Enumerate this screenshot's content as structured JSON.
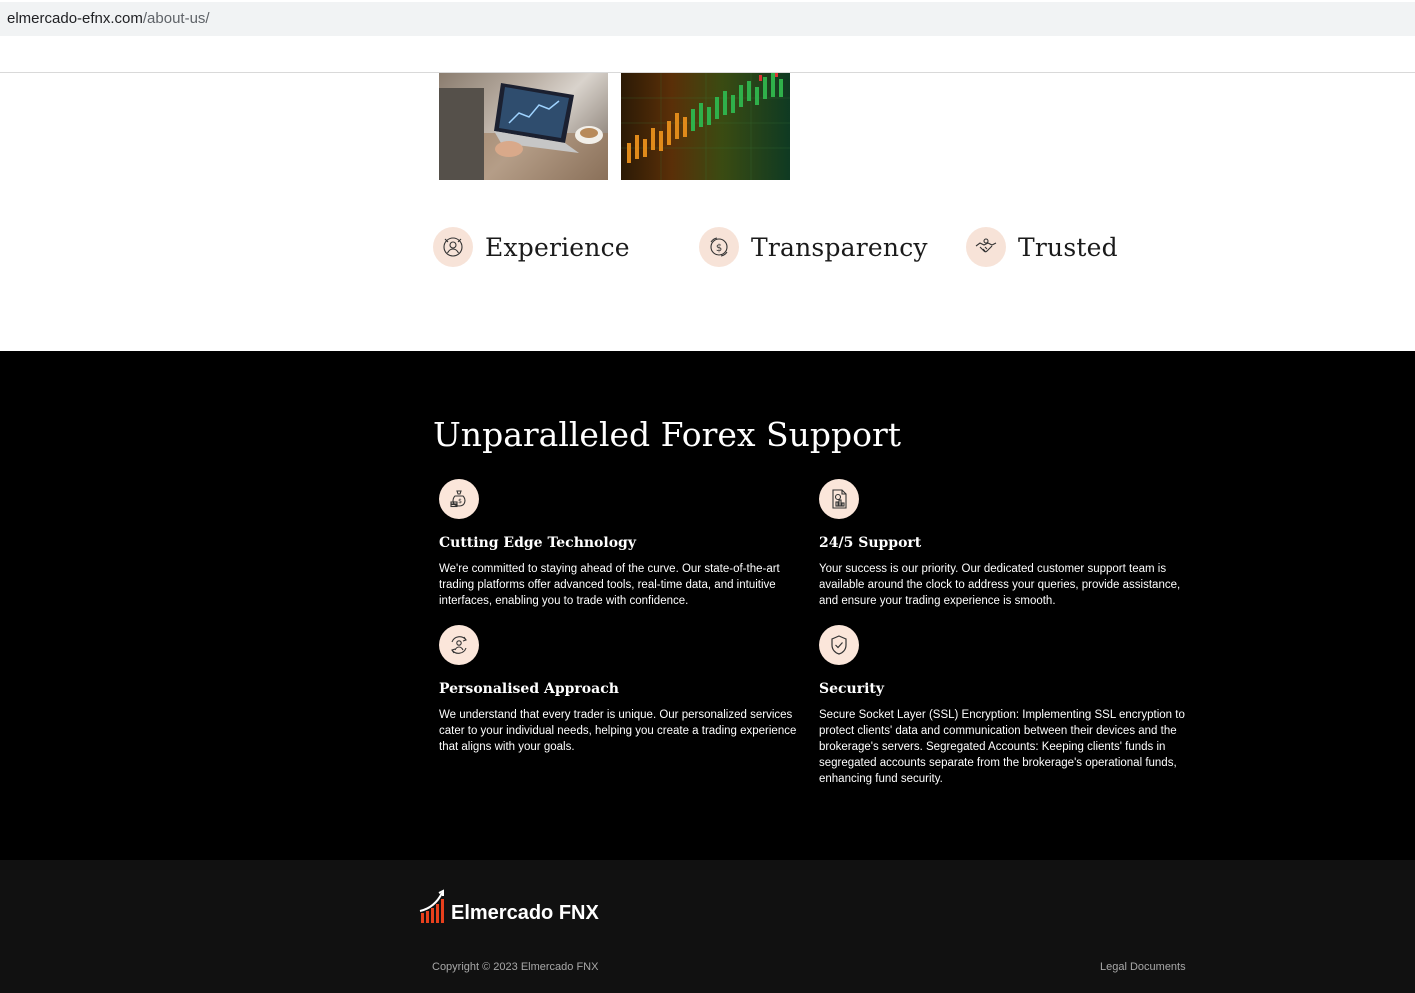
{
  "browser": {
    "url_host": "elmercado-efnx.com",
    "url_path": "/about-us/"
  },
  "features": [
    {
      "label": "Experience",
      "icon": "user-badge-icon"
    },
    {
      "label": "Transparency",
      "icon": "dollar-coin-icon"
    },
    {
      "label": "Trusted",
      "icon": "handshake-icon"
    }
  ],
  "support": {
    "title": "Unparalleled Forex Support",
    "cards": [
      {
        "title": "Cutting Edge Technology",
        "icon": "money-bag-icon",
        "text": "We're committed to staying ahead of the curve. Our state-of-the-art trading platforms offer advanced tools, real-time data, and intuitive interfaces, enabling you to trade with confidence."
      },
      {
        "title": "24/5 Support",
        "icon": "document-chart-icon",
        "text": "Your success is our priority. Our dedicated customer support team is available around the clock to address your queries, provide assistance, and ensure your trading experience is smooth."
      },
      {
        "title": "Personalised Approach",
        "icon": "user-cycle-icon",
        "text": "We understand that every trader is unique. Our personalized services cater to your individual needs, helping you create a trading experience that aligns with your goals."
      },
      {
        "title": "Security",
        "icon": "shield-check-icon",
        "text": "Secure Socket Layer (SSL) Encryption: Implementing SSL encryption to protect clients' data and communication between their devices and the brokerage's servers. Segregated Accounts: Keeping clients' funds in segregated accounts separate from the brokerage's operational funds, enhancing fund security."
      }
    ]
  },
  "footer": {
    "brand": "Elmercado FNX",
    "copyright": "Copyright © 2023 Elmercado FNX",
    "legal": "Legal Documents"
  },
  "colors": {
    "accent_circle": "#f7e3d8",
    "dark_bg": "#000000",
    "footer_bg": "#111111",
    "logo_red": "#e8401c"
  }
}
